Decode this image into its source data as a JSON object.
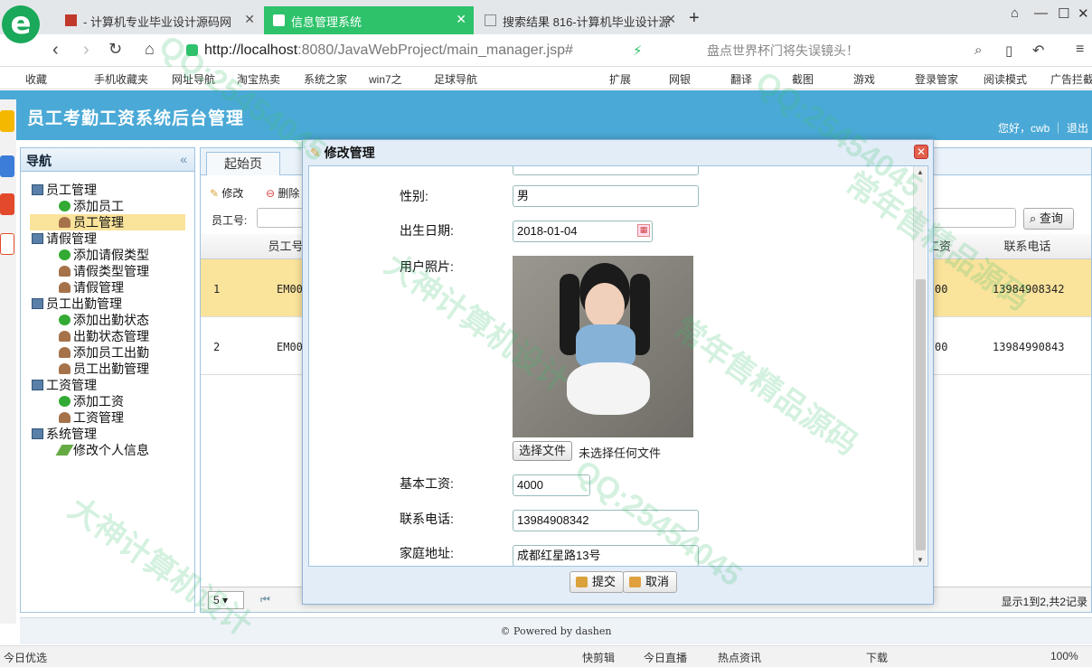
{
  "browser": {
    "tabs": [
      {
        "title": "- 计算机专业毕业设计源码网"
      },
      {
        "title": "信息管理系统"
      },
      {
        "title": "搜索结果 816-计算机毕业设计源"
      }
    ],
    "url_host": "http://localhost",
    "url_path": ":8080/JavaWebProject/main_manager.jsp#",
    "news": "盘点世界杯门将失误镜头！",
    "bookmarks": [
      "收藏",
      "手机收藏夹",
      "网址导航",
      "淘宝热卖",
      "系统之家",
      "win7之",
      "足球导航"
    ],
    "bookmarks_right": [
      "扩展",
      "网银",
      "翻译",
      "截图",
      "游戏",
      "登录管家",
      "阅读模式",
      "广告拦截"
    ]
  },
  "app": {
    "title": "员工考勤工资系统后台管理",
    "welcome": "您好，cwb ｜ 退出"
  },
  "nav": {
    "header": "导航",
    "groups": [
      {
        "label": "员工管理",
        "items": [
          "添加员工",
          "员工管理"
        ]
      },
      {
        "label": "请假管理",
        "items": [
          "添加请假类型",
          "请假类型管理",
          "请假管理"
        ]
      },
      {
        "label": "员工出勤管理",
        "items": [
          "添加出勤状态",
          "出勤状态管理",
          "添加员工出勤",
          "员工出勤管理"
        ]
      },
      {
        "label": "工资管理",
        "items": [
          "添加工资",
          "工资管理"
        ]
      },
      {
        "label": "系统管理",
        "items": [
          "修改个人信息"
        ]
      }
    ]
  },
  "main": {
    "home_tab": "起始页",
    "toolbar": {
      "edit": "修改",
      "delete": "删除",
      "search_label": "员工号:",
      "search_button": "查询"
    },
    "columns": {
      "emp_no": "员工号",
      "salary": "工资",
      "phone": "联系电话"
    },
    "rows": [
      {
        "index": "1",
        "emp_no": "EM00",
        "salary": "00",
        "phone": "13984908342"
      },
      {
        "index": "2",
        "emp_no": "EM00",
        "salary": "00",
        "phone": "13984990843"
      }
    ],
    "pager": {
      "page_size": "5",
      "info": "显示1到2,共2记录"
    }
  },
  "dialog": {
    "title": "修改管理",
    "fields": {
      "gender_label": "性别:",
      "gender": "男",
      "birth_label": "出生日期:",
      "birth": "2018-01-04",
      "photo_label": "用户照片:",
      "file_button": "选择文件",
      "file_status": "未选择任何文件",
      "salary_label": "基本工资:",
      "salary": "4000",
      "phone_label": "联系电话:",
      "phone": "13984908342",
      "address_label": "家庭地址:",
      "address": "成都红星路13号"
    },
    "submit": "提交",
    "cancel": "取消"
  },
  "footer": "© Powered by dashen",
  "statusbar": {
    "left": "今日优选",
    "items": [
      "快剪辑",
      "今日直播",
      "热点资讯",
      "下载"
    ],
    "zoom": "100%"
  },
  "watermarks": [
    "QQ:25454045",
    "大神计算机设计",
    "常年售精品源码",
    "QQ:25454045",
    "大神计算机设计",
    "常年售精品源码",
    "QQ:25454045"
  ]
}
